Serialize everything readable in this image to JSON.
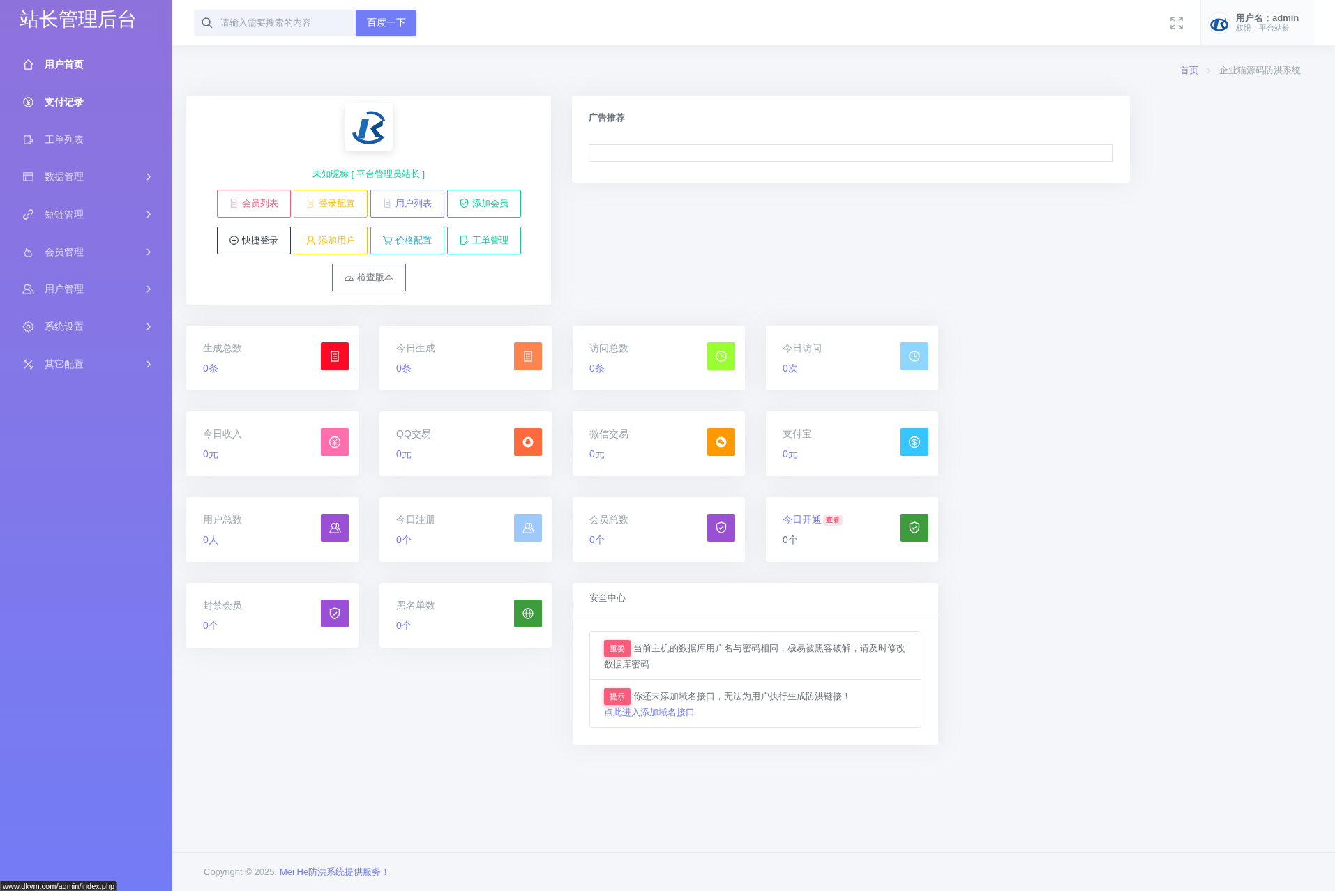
{
  "sidebar": {
    "title": "站长管理后台",
    "items": [
      {
        "label": "用户首页",
        "highlighted": true,
        "expandable": false
      },
      {
        "label": "支付记录",
        "highlighted": true,
        "expandable": false
      },
      {
        "label": "工单列表",
        "highlighted": false,
        "expandable": false
      },
      {
        "label": "数据管理",
        "highlighted": false,
        "expandable": true
      },
      {
        "label": "短链管理",
        "highlighted": false,
        "expandable": true
      },
      {
        "label": "会员管理",
        "highlighted": false,
        "expandable": true
      },
      {
        "label": "用户管理",
        "highlighted": false,
        "expandable": true
      },
      {
        "label": "系统设置",
        "highlighted": false,
        "expandable": true
      },
      {
        "label": "其它配置",
        "highlighted": false,
        "expandable": true
      }
    ]
  },
  "header": {
    "search": {
      "placeholder": "请输入需要搜索的内容",
      "button": "百度一下"
    },
    "user": {
      "name": "用户名：admin",
      "role": "权限：平台站长"
    }
  },
  "breadcrumb": [
    "首页",
    "企业猫源码防洪系统"
  ],
  "profile": {
    "name": "未知昵称 [ 平台管理员站长 ]",
    "buttons": [
      {
        "label": "会员列表",
        "color": "#fa5c7c"
      },
      {
        "label": "登录配置",
        "color": "#ffbc00"
      },
      {
        "label": "用户列表",
        "color": "#727cf5"
      },
      {
        "label": "添加会员",
        "color": "#0acf97"
      },
      {
        "label": "快捷登录",
        "color": "#313a46"
      },
      {
        "label": "添加用户",
        "color": "#ffbc00"
      },
      {
        "label": "价格配置",
        "color": "#39afd1"
      },
      {
        "label": "工单管理",
        "color": "#0acf97"
      },
      {
        "label": "检查版本",
        "color": "#6c757d"
      }
    ]
  },
  "ad": {
    "title": "广告推荐"
  },
  "stats": [
    {
      "label": "生成总数",
      "value": "0条",
      "color": "#ff0b26",
      "kind": "plain"
    },
    {
      "label": "今日生成",
      "value": "0条",
      "color": "#ff8450",
      "kind": "plain"
    },
    {
      "label": "访问总数",
      "value": "0条",
      "color": "#99ff33",
      "kind": "plain"
    },
    {
      "label": "今日访问",
      "value": "0次",
      "color": "#8fd6ff",
      "kind": "plain"
    },
    {
      "label": "今日收入",
      "value": "0元",
      "color": "#ff6fae",
      "kind": "plain"
    },
    {
      "label": "QQ交易",
      "value": "0元",
      "color": "#ff6b3d",
      "kind": "plain"
    },
    {
      "label": "微信交易",
      "value": "0元",
      "color": "#ff9900",
      "kind": "plain"
    },
    {
      "label": "支付宝",
      "value": "0元",
      "color": "#36c6ff",
      "kind": "plain"
    },
    {
      "label": "用户总数",
      "value": "0人",
      "color": "#9a50d4",
      "kind": "plain"
    },
    {
      "label": "今日注册",
      "value": "0个",
      "color": "#9ec9ff",
      "kind": "plain"
    },
    {
      "label": "会员总数",
      "value": "0个",
      "color": "#9a50d4",
      "kind": "plain"
    },
    {
      "label": "今日开通",
      "value": "0个",
      "color": "#3d9d3d",
      "kind": "link",
      "badge": "查看"
    },
    {
      "label": "封禁会员",
      "value": "0个",
      "color": "#9a50d4",
      "kind": "plain"
    },
    {
      "label": "黑名单数",
      "value": "0个",
      "color": "#3d9d3d",
      "kind": "plain"
    }
  ],
  "security": {
    "title": "安全中心",
    "items": [
      {
        "badge": "重要",
        "text": "当前主机的数据库用户名与密码相同，极易被黑客破解，请及时修改数据库密码"
      },
      {
        "badge": "提示",
        "text": "你还未添加域名接口，无法为用户执行生成防洪链接！",
        "link": "点此进入添加域名接口"
      }
    ]
  },
  "footer": {
    "text": "Copyright © 2025.",
    "link": "Mei He防洪系统提供服务！"
  },
  "status_url": "www.dkym.com/admin/index.php"
}
